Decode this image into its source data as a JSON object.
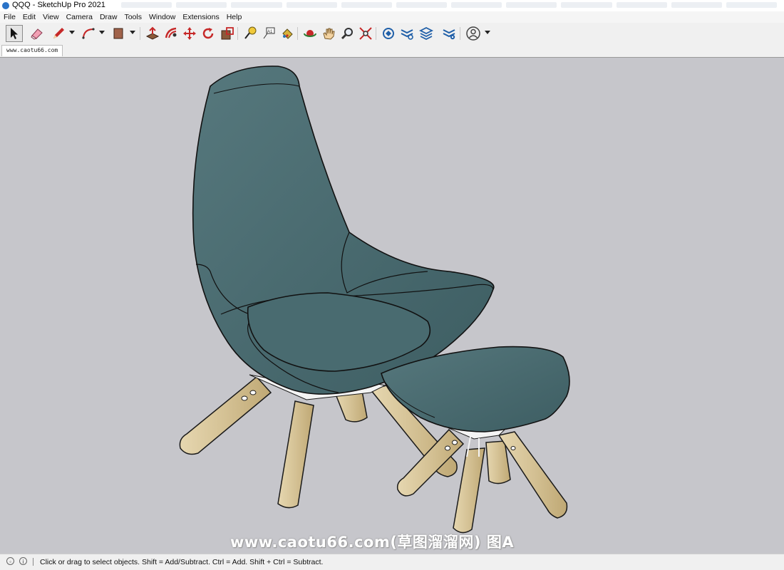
{
  "window": {
    "title": "QQQ - SketchUp Pro 2021"
  },
  "menu": [
    "File",
    "Edit",
    "View",
    "Camera",
    "Draw",
    "Tools",
    "Window",
    "Extensions",
    "Help"
  ],
  "scene_tab": "www.caotu66.com",
  "watermark": "www.caotu66.com(草图溜溜网) 图A",
  "status": {
    "text": "Click or drag to select objects. Shift = Add/Subtract. Ctrl = Add. Shift + Ctrl = Subtract."
  },
  "tools": {
    "select": "select-arrow-icon",
    "eraser": "eraser-icon",
    "line": "pencil-icon",
    "arc": "arc-icon",
    "shape": "rectangle-icon",
    "push_pull": "push-pull-icon",
    "offset": "offset-icon",
    "move": "move-icon",
    "rotate": "rotate-icon",
    "scale": "scale-icon",
    "tape": "tape-measure-icon",
    "text": "text-icon",
    "paint": "paint-bucket-icon",
    "orbit": "orbit-icon",
    "pan": "pan-hand-icon",
    "zoom": "zoom-icon",
    "zoom_extents": "zoom-extents-icon",
    "warehouse": "3d-warehouse-icon",
    "extension_warehouse": "extension-warehouse-icon",
    "layout": "layout-icon",
    "extension_manager": "extension-manager-icon",
    "account": "account-icon"
  },
  "colors": {
    "fabric": "#4a6b70",
    "wood": "#d9c79c",
    "viewport_bg": "#c6c6cb"
  }
}
